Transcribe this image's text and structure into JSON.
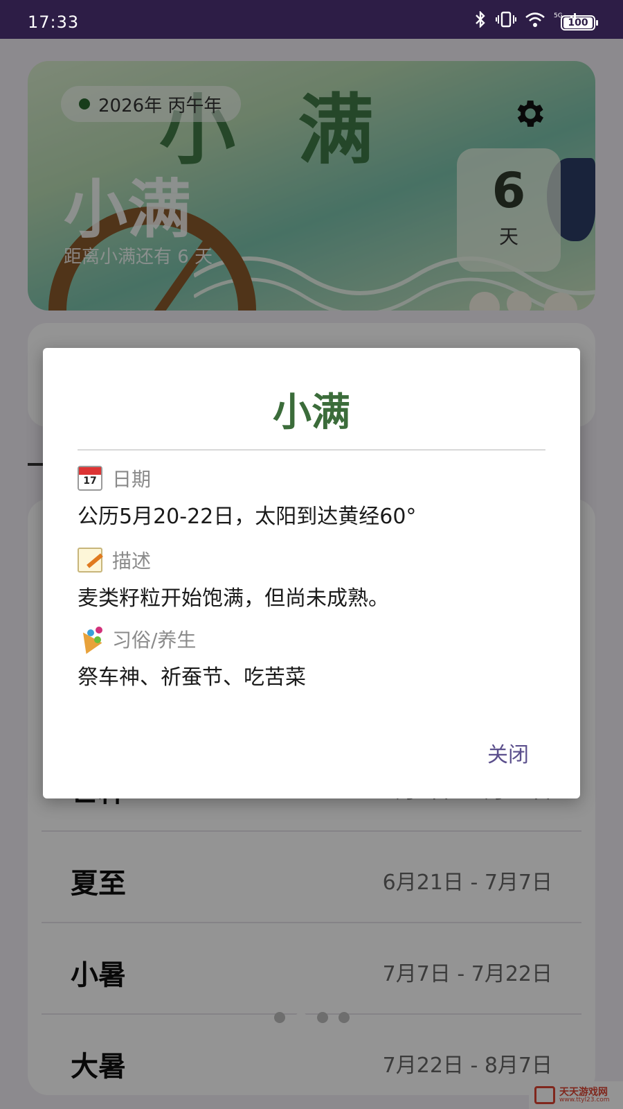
{
  "status_bar": {
    "time": "17:33",
    "battery": "100",
    "network": "5G"
  },
  "hero": {
    "year_label": "2026年 丙午年",
    "term_name": "小满",
    "art_title": "小满",
    "countdown_text": "距离小满还有 6 天",
    "days_count": "6",
    "days_unit": "天"
  },
  "term_list": [
    {
      "name": "芒种",
      "range": "6月5日 - 6月21日"
    },
    {
      "name": "夏至",
      "range": "6月21日 - 7月7日"
    },
    {
      "name": "小暑",
      "range": "7月7日 - 7月22日"
    },
    {
      "name": "大暑",
      "range": "7月22日 - 8月7日"
    }
  ],
  "pager": {
    "count": 4,
    "active_index": 1
  },
  "dialog": {
    "title": "小满",
    "date_label": "日期",
    "date_value": "公历5月20-22日，太阳到达黄经60°",
    "desc_label": "描述",
    "desc_value": "麦类籽粒开始饱满，但尚未成熟。",
    "custom_label": "习俗/养生",
    "custom_value": "祭车神、祈蚕节、吃苦菜",
    "calendar_icon_text": "17",
    "close_label": "关闭"
  },
  "watermark": {
    "name": "天天游戏网",
    "url": "www.ttyl23.com"
  },
  "colors": {
    "status_bar": "#2d1d46",
    "dialog_title": "#3b6c3a",
    "close_button": "#5b4f8c",
    "scrim": "rgba(0,0,0,0.42)"
  },
  "icons": {
    "settings": "gear-icon",
    "date": "calendar-icon",
    "description": "memo-icon",
    "customs": "party-popper-icon"
  }
}
